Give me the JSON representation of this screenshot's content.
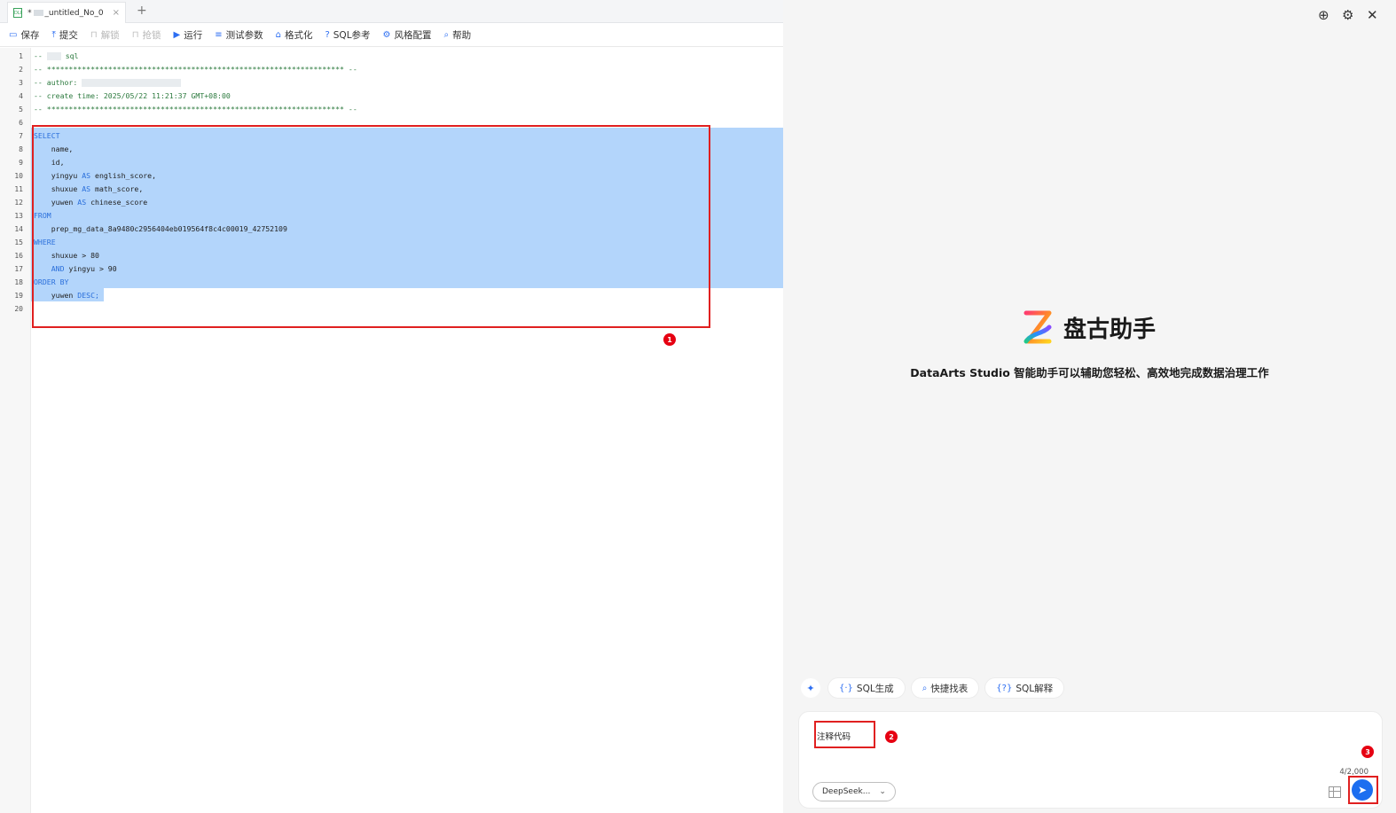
{
  "tab": {
    "icon_text": "DLI",
    "modified_marker": "*",
    "title": "_untitled_No_0",
    "close_glyph": "×",
    "add_glyph": "+"
  },
  "toolbar": {
    "save": "保存",
    "submit": "提交",
    "unlock": "解锁",
    "grab_lock": "抢锁",
    "run": "运行",
    "test_params": "测试参数",
    "format": "格式化",
    "sql_ref": "SQL参考",
    "style_config": "风格配置",
    "help": "帮助"
  },
  "editor": {
    "line_numbers": [
      "1",
      "2",
      "3",
      "4",
      "5",
      "6",
      "7",
      "8",
      "9",
      "10",
      "11",
      "12",
      "13",
      "14",
      "15",
      "16",
      "17",
      "18",
      "19",
      "20"
    ],
    "lines": {
      "l1": " sql",
      "l2": "-- ******************************************************************** --",
      "l3": "-- author: ",
      "l4": "-- create time: 2025/05/22 11:21:37 GMT+08:00",
      "l5": "-- ******************************************************************** --",
      "l7": "SELECT",
      "l8": "    name,",
      "l9": "    id,",
      "l10a": "    yingyu ",
      "l10b": "AS",
      "l10c": " english_score,",
      "l11a": "    shuxue ",
      "l11b": "AS",
      "l11c": " math_score,",
      "l12a": "    yuwen ",
      "l12b": "AS",
      "l12c": " chinese_score",
      "l13": "FROM",
      "l14": "    prep_mg_data_8a9480c2956404eb019564f8c4c00019_42752109",
      "l15": "WHERE",
      "l16": "    shuxue > 80",
      "l17a": "    ",
      "l17b": "AND",
      "l17c": " yingyu > 90",
      "l18": "ORDER BY",
      "l19a": "    yuwen ",
      "l19b": "DESC",
      "l19c": ";",
      "comment_prefix": "-- "
    }
  },
  "badges": {
    "b1": "1",
    "b2": "2",
    "b3": "3"
  },
  "assistant": {
    "brand": "盘古助手",
    "subtitle": "DataArts Studio 智能助手可以辅助您轻松、高效地完成数据治理工作",
    "chips": [
      "SQL生成",
      "快捷找表",
      "SQL解释"
    ],
    "input_value": "注释代码",
    "counter": "4/2,000",
    "model": "DeepSeek..."
  },
  "colors": {
    "accent": "#1c6ef0",
    "highlight": "#e02020",
    "selection": "#b3d5fb"
  }
}
